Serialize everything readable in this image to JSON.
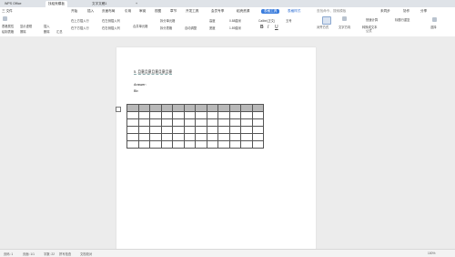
{
  "titlebar": {
    "tabs": [
      {
        "label": "WPS Office"
      },
      {
        "label": "找稻壳模板"
      },
      {
        "label": "文字文稿1"
      },
      {
        "label": "+"
      }
    ]
  },
  "menubar": {
    "items": [
      "三 文件",
      "开始",
      "插入",
      "页面布局",
      "引用",
      "审阅",
      "视图",
      "章节",
      "开发工具",
      "会员专享",
      "稻壳资源",
      "表格工具",
      "表格样式"
    ],
    "search_placeholder": "查找命令、搜索模板",
    "right_items": [
      "未同步",
      "协作",
      "分享"
    ]
  },
  "ribbon": {
    "row1": [
      "表格属性",
      "显示虚框",
      "插入",
      "在上方插入行",
      "在左侧插入列",
      "合并单元格",
      "拆分单元格",
      "高度",
      "宽度",
      "对齐方式",
      "文字方向",
      "快速计算",
      "标题行重复",
      "选择"
    ],
    "row2": [
      "绘制表格",
      "擦除",
      "删除",
      "汇总",
      "在下方插入行",
      "在右侧插入列",
      "拆分表格",
      "自动调整",
      "转换成文本",
      "公式"
    ],
    "height_value": "0.88厘米",
    "width_value": "1.89厘米",
    "font_name": "Calibri(正文)",
    "font_size": "五号",
    "bold": "B",
    "italic": "I",
    "underline": "U"
  },
  "document": {
    "line1": "5. 且意且意且意且意且意",
    "line2": "Answer:",
    "line3": "Bb"
  },
  "table": {
    "rows": 6,
    "cols": 12
  },
  "status": {
    "left": [
      "页码: 1",
      "页面: 1/1",
      "字数: 22",
      "拼写检查",
      "文档校对"
    ],
    "right_zoom": "100%"
  }
}
